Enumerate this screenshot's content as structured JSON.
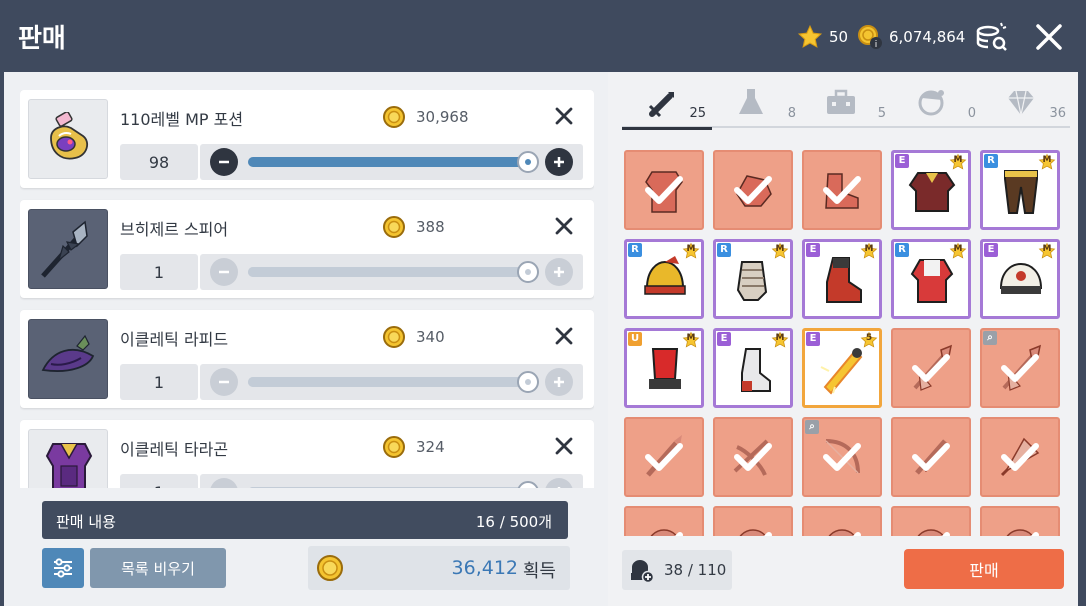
{
  "header": {
    "title": "판매",
    "stars": "50",
    "mesos": "6,074,864"
  },
  "sell_list": [
    {
      "name": "110레벨 MP 포션",
      "price": "30,968",
      "qty": "98",
      "fill": 1.0,
      "enabled": true,
      "thumb": "potion-icon",
      "thumb_bg": "light"
    },
    {
      "name": "브히제르 스피어",
      "price": "388",
      "qty": "1",
      "fill": 1.0,
      "enabled": false,
      "thumb": "spear-icon",
      "thumb_bg": "dark"
    },
    {
      "name": "이클레틱 라피드",
      "price": "340",
      "qty": "1",
      "fill": 1.0,
      "enabled": false,
      "thumb": "hat-icon",
      "thumb_bg": "dark"
    },
    {
      "name": "이클레틱 타라곤",
      "price": "324",
      "qty": "1",
      "fill": 1.0,
      "enabled": false,
      "thumb": "armor-icon",
      "thumb_bg": "light"
    }
  ],
  "summary": {
    "label": "판매 내용",
    "count": "16 / 500개"
  },
  "buttons": {
    "clear": "목록 비우기",
    "sell": "판매"
  },
  "total": {
    "amount": "36,412",
    "label": "획득"
  },
  "tabs": [
    {
      "icon": "sword-icon",
      "count": "25",
      "active": true
    },
    {
      "icon": "potion-icon",
      "count": "8",
      "active": false
    },
    {
      "icon": "briefcase-icon",
      "count": "5",
      "active": false
    },
    {
      "icon": "character-icon",
      "count": "0",
      "active": false
    },
    {
      "icon": "diamond-icon",
      "count": "36",
      "active": false
    }
  ],
  "inventory": [
    {
      "item": "armor",
      "state": "selected"
    },
    {
      "item": "glove",
      "state": "selected"
    },
    {
      "item": "shoe",
      "state": "selected"
    },
    {
      "item": "overall",
      "state": "normal",
      "grade": "E",
      "star": "M"
    },
    {
      "item": "pants",
      "state": "normal",
      "grade": "R",
      "star": "M"
    },
    {
      "item": "helmet",
      "state": "normal",
      "grade": "R",
      "star": "M"
    },
    {
      "item": "gauntlet",
      "state": "normal",
      "grade": "R",
      "star": "M"
    },
    {
      "item": "boot",
      "state": "normal",
      "grade": "E",
      "star": "M"
    },
    {
      "item": "robe",
      "state": "normal",
      "grade": "R",
      "star": "M"
    },
    {
      "item": "cap",
      "state": "normal",
      "grade": "E",
      "star": "M"
    },
    {
      "item": "fez",
      "state": "normal",
      "grade": "U",
      "star": "M"
    },
    {
      "item": "sock",
      "state": "normal",
      "grade": "E",
      "star": "M"
    },
    {
      "item": "crystal",
      "state": "highlight",
      "grade": "E",
      "star": "5"
    },
    {
      "item": "spear",
      "state": "selected"
    },
    {
      "item": "spear",
      "state": "selected",
      "grade": "Q"
    },
    {
      "item": "dagger",
      "state": "selected"
    },
    {
      "item": "crossbow",
      "state": "selected"
    },
    {
      "item": "bow",
      "state": "selected",
      "grade": "Q"
    },
    {
      "item": "sword",
      "state": "selected"
    },
    {
      "item": "fan",
      "state": "selected"
    },
    {
      "item": "misc",
      "state": "selected"
    },
    {
      "item": "misc",
      "state": "selected"
    },
    {
      "item": "misc",
      "state": "selected"
    },
    {
      "item": "misc",
      "state": "selected"
    },
    {
      "item": "misc",
      "state": "selected"
    }
  ],
  "capacity": "38 / 110",
  "colors": {
    "header": "#3f4a5e",
    "accent_blue": "#4f88b8",
    "sell_orange": "#ee6d47",
    "selected_cell": "#eea088",
    "epic_purple": "#a579d6"
  }
}
